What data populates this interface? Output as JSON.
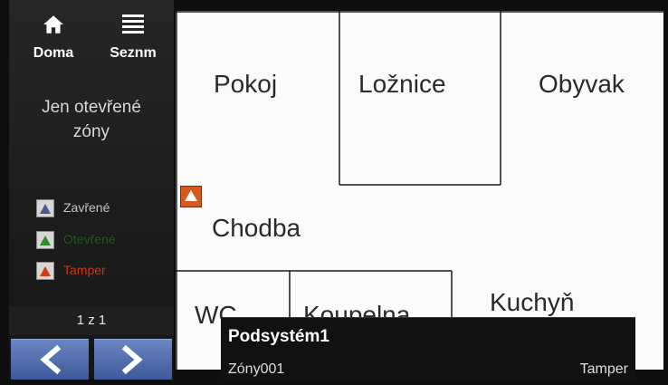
{
  "nav": {
    "home_label": "Doma",
    "list_label": "Seznm"
  },
  "filter_line1": "Jen otevřené",
  "filter_line2": "zóny",
  "legend": [
    {
      "label": "Zavřené",
      "text_color": "#c4c4c4",
      "icon_color": "#4a5a8c"
    },
    {
      "label": "Otevřené",
      "text_color": "#1f5a1f",
      "icon_color": "#2f8c2f"
    },
    {
      "label": "Tamper",
      "text_color": "#c23a1a",
      "icon_color": "#d23a1a"
    }
  ],
  "pagination": {
    "label": "1 z 1"
  },
  "rooms": {
    "pokoj": "Pokoj",
    "loznice": "Ložnice",
    "obyvak": "Obyvak",
    "chodba": "Chodba",
    "wc": "WC",
    "koupelna": "Koupelna",
    "kuchyn": "Kuchyň"
  },
  "popup": {
    "title": "Podsystém1",
    "zone": "Zóny001",
    "status": "Tamper"
  },
  "colors": {
    "accent_blue": "#4f6aac",
    "tamper_orange": "#d55a1c",
    "map_bg": "#fbfbfb"
  }
}
